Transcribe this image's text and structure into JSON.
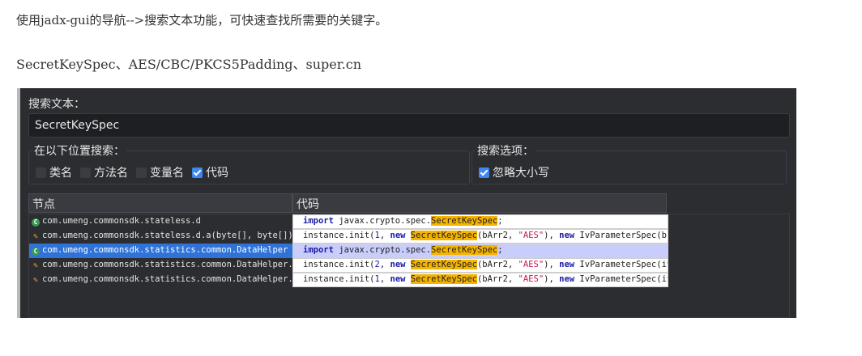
{
  "article": {
    "line1": "使用jadx-gui的导航-->搜索文本功能，可快速查找所需要的关键字。",
    "line2": "SecretKeySpec、AES/CBC/PKCS5Padding、super.cn"
  },
  "dialog": {
    "search_label": "搜索文本：",
    "search_value": "SecretKeySpec",
    "where_title": "在以下位置搜索：",
    "where_options": [
      {
        "label": "类名",
        "checked": false
      },
      {
        "label": "方法名",
        "checked": false
      },
      {
        "label": "变量名",
        "checked": false
      },
      {
        "label": "代码",
        "checked": true
      }
    ],
    "options_title": "搜索选项：",
    "ignore_case_label": "忽略大小写",
    "ignore_case_checked": true,
    "columns": {
      "node": "节点",
      "code": "代码"
    },
    "rows": [
      {
        "icon": "class-icon",
        "node": "com.umeng.commonsdk.stateless.d",
        "selected": false,
        "code": [
          "kw:import",
          " javax.crypto.spec.",
          "hl:SecretKeySpec",
          ";"
        ]
      },
      {
        "icon": "method-icon",
        "node": "com.umeng.commonsdk.stateless.d.a(byte[], byte[])...",
        "selected": false,
        "code": [
          "instance.init(",
          "num:1",
          ", ",
          "kw:new",
          " ",
          "hl:SecretKeySpec",
          "(bArr2, ",
          "str:\"AES\"",
          "), ",
          "kw:new",
          " IvParameterSpec(b));"
        ]
      },
      {
        "icon": "class-icon",
        "node": "com.umeng.commonsdk.statistics.common.DataHelper",
        "selected": true,
        "code": [
          "kw:import",
          " javax.crypto.spec.",
          "hl:SecretKeySpec",
          ";"
        ]
      },
      {
        "icon": "method-icon",
        "node": "com.umeng.commonsdk.statistics.common.DataHelper....",
        "selected": false,
        "code": [
          "instance.init(",
          "num:2",
          ", ",
          "kw:new",
          " ",
          "hl:SecretKeySpec",
          "(bArr2, ",
          "str:\"AES\"",
          "), ",
          "kw:new",
          " IvParameterSpec(iv));"
        ]
      },
      {
        "icon": "method-icon",
        "node": "com.umeng.commonsdk.statistics.common.DataHelper....",
        "selected": false,
        "code": [
          "instance.init(",
          "num:1",
          ", ",
          "kw:new",
          " ",
          "hl:SecretKeySpec",
          "(bArr2, ",
          "str:\"AES\"",
          "), ",
          "kw:new",
          " IvParameterSpec(iv));"
        ]
      }
    ]
  }
}
